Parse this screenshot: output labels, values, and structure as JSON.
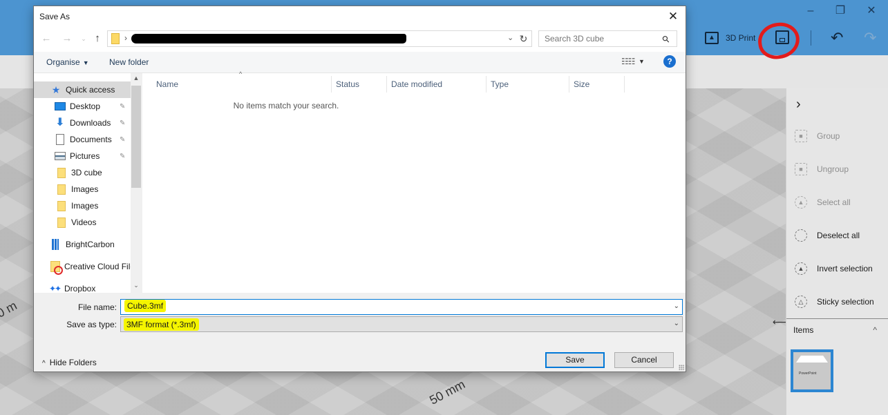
{
  "app": {
    "window_controls": {
      "minimize": "–",
      "restore": "❐",
      "close": "✕"
    },
    "toolbar": {
      "print_label": "3D Print",
      "save_icon": "floppy-disk-icon",
      "undo_icon": "undo-icon",
      "redo_icon": "redo-icon"
    },
    "right_panel": {
      "collapse_icon": "chevron-right-icon",
      "items": [
        {
          "label": "Group",
          "icon": "group-icon",
          "enabled": false
        },
        {
          "label": "Ungroup",
          "icon": "ungroup-icon",
          "enabled": false
        },
        {
          "label": "Select all",
          "icon": "select-all-icon",
          "enabled": false
        },
        {
          "label": "Deselect all",
          "icon": "deselect-all-icon",
          "enabled": true
        },
        {
          "label": "Invert selection",
          "icon": "invert-selection-icon",
          "enabled": true
        },
        {
          "label": "Sticky selection",
          "icon": "sticky-selection-icon",
          "enabled": true
        }
      ],
      "items_section_label": "Items",
      "items_section_caret": "^"
    },
    "viewport": {
      "model_text": "PowerPoint",
      "dimension_label": "50 mm",
      "dimension_label_left": "0 m"
    }
  },
  "dialog": {
    "title": "Save As",
    "close_glyph": "✕",
    "nav": {
      "back": "←",
      "forward": "→",
      "recent": "⌄",
      "up": "↑",
      "breadcrumb_separator": "›",
      "address_dropdown": "⌄",
      "refresh": "↻"
    },
    "search": {
      "placeholder": "Search 3D cube",
      "icon": "⚲"
    },
    "commands": {
      "organise": "Organise",
      "new_folder": "New folder",
      "view_icon": "☷☷",
      "help": "?"
    },
    "nav_pane": {
      "items": [
        {
          "label": "Quick access",
          "icon": "star-icon",
          "pinned": false,
          "selected": true
        },
        {
          "label": "Desktop",
          "icon": "desktop-icon",
          "pinned": true
        },
        {
          "label": "Downloads",
          "icon": "downloads-icon",
          "pinned": true
        },
        {
          "label": "Documents",
          "icon": "documents-icon",
          "pinned": true
        },
        {
          "label": "Pictures",
          "icon": "pictures-icon",
          "pinned": true
        },
        {
          "label": "3D cube",
          "icon": "folder-icon",
          "pinned": false
        },
        {
          "label": "Images",
          "icon": "folder-icon",
          "pinned": false
        },
        {
          "label": "Images",
          "icon": "folder-icon",
          "pinned": false
        },
        {
          "label": "Videos",
          "icon": "folder-icon",
          "pinned": false
        },
        {
          "label": "BrightCarbon",
          "icon": "building-icon",
          "pinned": false
        },
        {
          "label": "Creative Cloud Files",
          "icon": "creative-cloud-icon",
          "pinned": false
        },
        {
          "label": "Dropbox",
          "icon": "dropbox-icon",
          "pinned": false
        }
      ],
      "pin_glyph": "📌"
    },
    "file_list": {
      "columns": [
        "Name",
        "Status",
        "Date modified",
        "Type",
        "Size"
      ],
      "empty_message": "No items match your search."
    },
    "file_name": {
      "label": "File name:",
      "value": "Cube.3mf"
    },
    "save_as_type": {
      "label": "Save as type:",
      "value": "3MF format (*.3mf)"
    },
    "hide_folders": "Hide Folders",
    "buttons": {
      "save": "Save",
      "cancel": "Cancel"
    }
  }
}
